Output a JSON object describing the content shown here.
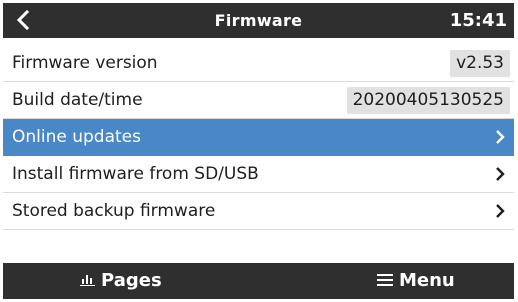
{
  "header": {
    "back_icon": "chevron-left-icon",
    "title": "Firmware",
    "time": "15:41"
  },
  "rows": [
    {
      "label": "Firmware version",
      "value": "v2.53"
    },
    {
      "label": "Build date/time",
      "value": "20200405130525"
    },
    {
      "label": "Online updates",
      "selected": true,
      "icon": "chevron-right-icon"
    },
    {
      "label": "Install firmware from SD/USB",
      "icon": "chevron-right-icon"
    },
    {
      "label": "Stored backup firmware",
      "icon": "chevron-right-icon"
    }
  ],
  "footer": {
    "pages_label": "Pages",
    "pages_icon": "bar-chart-icon",
    "menu_label": "Menu",
    "menu_icon": "hamburger-menu-icon"
  },
  "colors": {
    "header_bg": "#2f2f2f",
    "selected_bg": "#4a87c7",
    "value_box_bg": "#e1e1e1",
    "text": "#1e1e1e"
  }
}
